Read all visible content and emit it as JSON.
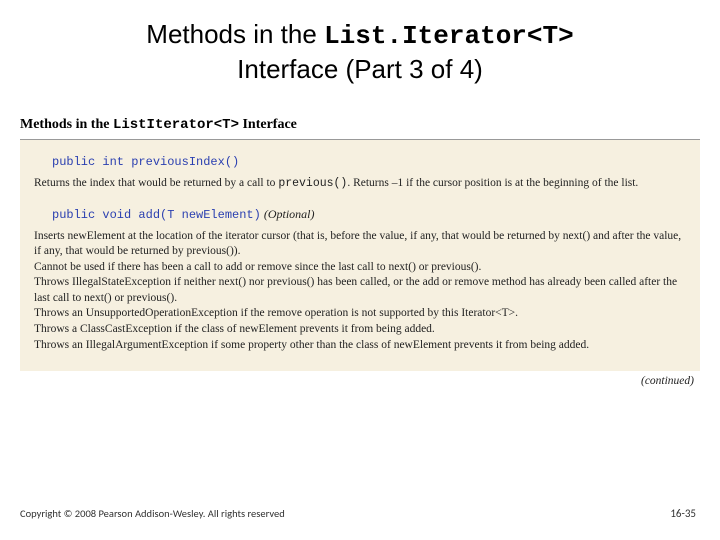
{
  "title": {
    "pre": "Methods in the ",
    "code": "List.Iterator<T>",
    "line2": "Interface (Part 3 of 4)"
  },
  "panel": {
    "header_pre": "Methods in the ",
    "header_mono": "ListIterator<T>",
    "header_post": " Interface",
    "method1": {
      "sig": "public int previousIndex()",
      "desc_a": "Returns the index that would be returned by a call to ",
      "desc_a_mono": "previous()",
      "desc_b": ". Returns –1 if the cursor position is at the beginning of the list."
    },
    "method2": {
      "sig": "public void add(T newElement)",
      "opt": " (Optional)",
      "p1": "Inserts newElement at the location of the iterator cursor (that is, before the value, if any, that would be returned by next() and after the value, if any, that would be returned by previous()).",
      "p2": "Cannot be used if there has been a call to add or remove since the last call to next() or previous().",
      "p3": "Throws IllegalStateException if neither next() nor previous() has been called, or the add or remove method has already been called after the last call to next() or previous().",
      "p4": "Throws an UnsupportedOperationException if the remove operation is not supported by this Iterator<T>.",
      "p5": "Throws a ClassCastException if the class of newElement prevents it from being added.",
      "p6": "Throws an IllegalArgumentException if some property other than the class of newElement prevents it from being added."
    },
    "continued": "(continued)"
  },
  "footer": {
    "copyright": "Copyright © 2008 Pearson Addison-Wesley. All rights reserved",
    "page": "16-35"
  }
}
